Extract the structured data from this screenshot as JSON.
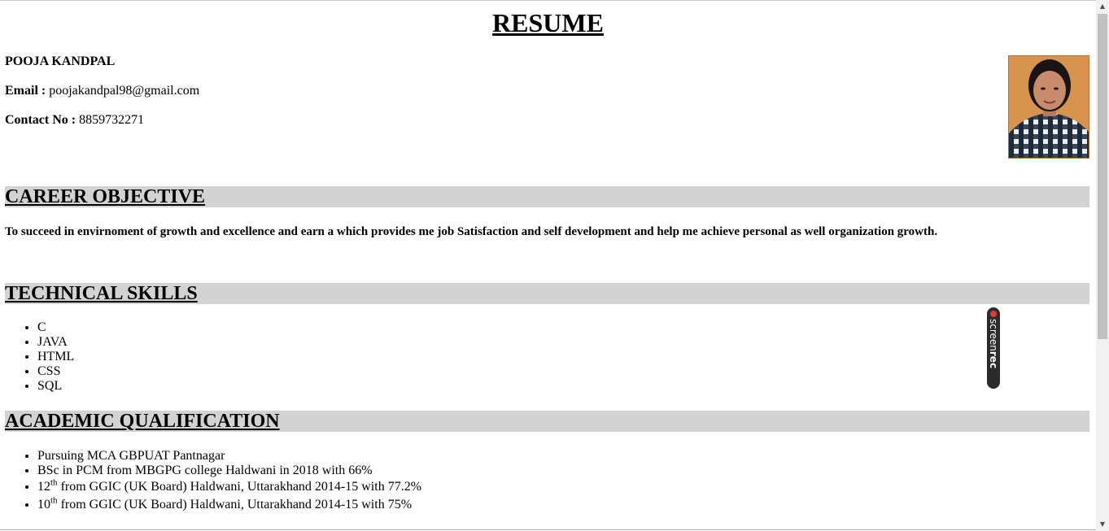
{
  "header": {
    "title": "RESUME"
  },
  "personal": {
    "name": "POOJA KANDPAL",
    "email_label": "Email :",
    "email_value": "poojakandpal98@gmail.com",
    "contact_label": "Contact No :",
    "contact_value": "8859732271"
  },
  "sections": {
    "career": {
      "title": "CAREER OBJECTIVE",
      "text": "To succeed in envirnoment of growth and excellence and earn a which provides me job Satisfaction and self development and help me achieve personal as well organization growth."
    },
    "skills": {
      "title": "TECHNICAL SKILLS",
      "items": [
        "C",
        "JAVA",
        "HTML",
        "CSS",
        "SQL"
      ]
    },
    "academic": {
      "title": "ACADEMIC QUALIFICATION",
      "items": [
        {
          "text": "Pursuing MCA GBPUAT Pantnagar"
        },
        {
          "text": "BSc in PCM from MBGPG college Haldwani in 2018 with 66%"
        },
        {
          "prefix": "12",
          "sup": "th",
          "text": " from GGIC (UK Board) Haldwani, Uttarakhand 2014-15 with 77.2%"
        },
        {
          "prefix": "10",
          "sup": "th",
          "text": " from GGIC (UK Board) Haldwani, Uttarakhand 2014-15 with 75%"
        }
      ]
    }
  },
  "overlay": {
    "label_light": "screen",
    "label_bold": "rec"
  },
  "icons": {
    "scroll_up": "arrow-up-icon",
    "scroll_down": "arrow-down-icon",
    "record": "record-dot-icon"
  },
  "colors": {
    "section_bg": "#d3d3d3",
    "photo_bg": "#d8944e",
    "record_dot": "#e53935"
  }
}
